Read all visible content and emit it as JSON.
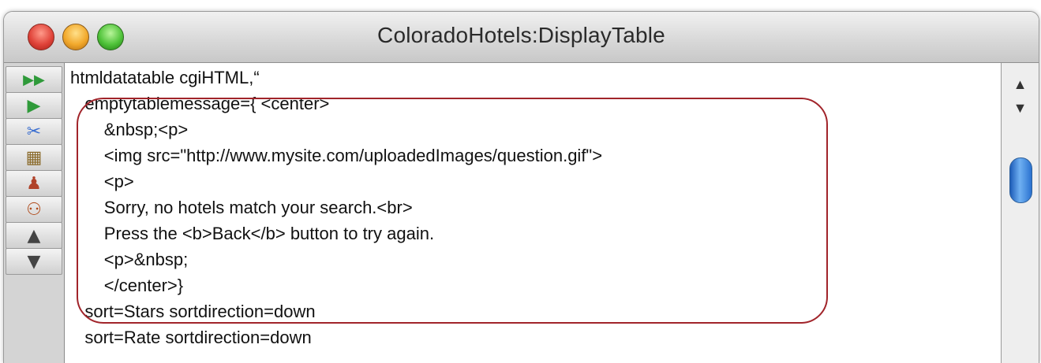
{
  "window": {
    "title": "ColoradoHotels:DisplayTable"
  },
  "toolbar": {
    "buttons": [
      {
        "name": "run-all-button",
        "icon": "fast-forward-icon",
        "glyph": "▶▶",
        "color": "#2f9a3a"
      },
      {
        "name": "run-button",
        "icon": "play-icon",
        "glyph": "▶",
        "color": "#2f9a3a"
      },
      {
        "name": "cut-button",
        "icon": "scissors-icon",
        "glyph": "✂",
        "color": "#3a6ed0"
      },
      {
        "name": "procedure-button",
        "icon": "grid-icon",
        "glyph": "▦",
        "color": "#8a6a2a"
      },
      {
        "name": "stamp-button",
        "icon": "stamp-icon",
        "glyph": "♟",
        "color": "#b0432a"
      },
      {
        "name": "debug-button",
        "icon": "bugs-icon",
        "glyph": "⚇",
        "color": "#b04a1a"
      },
      {
        "name": "scroll-up-button",
        "icon": "triangle-up-icon",
        "glyph": "▲",
        "color": "#444444"
      },
      {
        "name": "scroll-down-button",
        "icon": "triangle-down-icon",
        "glyph": "▼",
        "color": "#444444"
      }
    ]
  },
  "editor": {
    "lines": [
      "htmldatatable cgiHTML,“",
      "   emptytablemessage={ <center>",
      "       &nbsp;<p>",
      "       <img src=\"http://www.mysite.com/uploadedImages/question.gif\">",
      "       <p>",
      "       Sorry, no hotels match your search.<br>",
      "       Press the <b>Back</b> button to try again.",
      "       <p>&nbsp;",
      "       </center>}",
      "   sort=Stars sortdirection=down",
      "   sort=Rate sortdirection=down"
    ],
    "highlight_color": "#a1242a"
  },
  "scrollbar": {
    "up_glyph": "▲",
    "down_glyph": "▼"
  }
}
